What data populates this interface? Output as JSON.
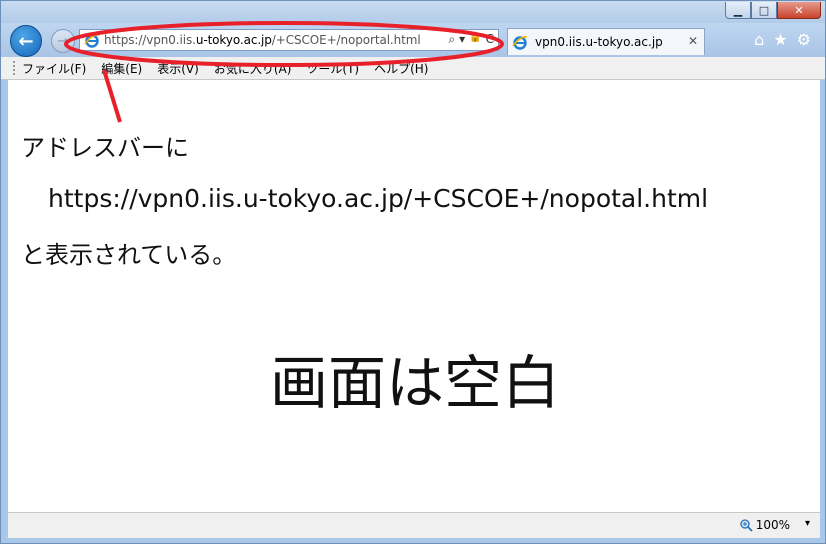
{
  "window": {
    "buttons": {
      "minimize": "▁",
      "maximize": "□",
      "close": "✕"
    }
  },
  "navbar": {
    "back_icon": "←",
    "forward_icon": "→",
    "address": {
      "scheme": "https://vpn0.iis.",
      "host": "u-tokyo.ac.jp",
      "path": "/+CSCOE+/noportal.html"
    },
    "address_icons": {
      "search": "⌕",
      "dropdown": "▾",
      "lock": "🔒",
      "refresh": "C"
    },
    "tab": {
      "title": "vpn0.iis.u-tokyo.ac.jp",
      "close": "✕"
    },
    "toolbar_icons": {
      "home": "⌂",
      "favorites": "★",
      "settings": "⚙"
    }
  },
  "menubar": {
    "items": [
      "ファイル(F)",
      "編集(E)",
      "表示(V)",
      "お気に入り(A)",
      "ツール(T)",
      "ヘルプ(H)"
    ]
  },
  "content": {
    "line1": "アドレスバーに",
    "url_line": "https://vpn0.iis.u-tokyo.ac.jp/+CSCOE+/nopotal.html",
    "line2": "と表示されている。",
    "blank_note": "画面は空白"
  },
  "statusbar": {
    "zoom": "100%",
    "zoom_dropdown": "▾"
  },
  "colors": {
    "annotation": "#e8202a",
    "accent": "#1565b8"
  }
}
